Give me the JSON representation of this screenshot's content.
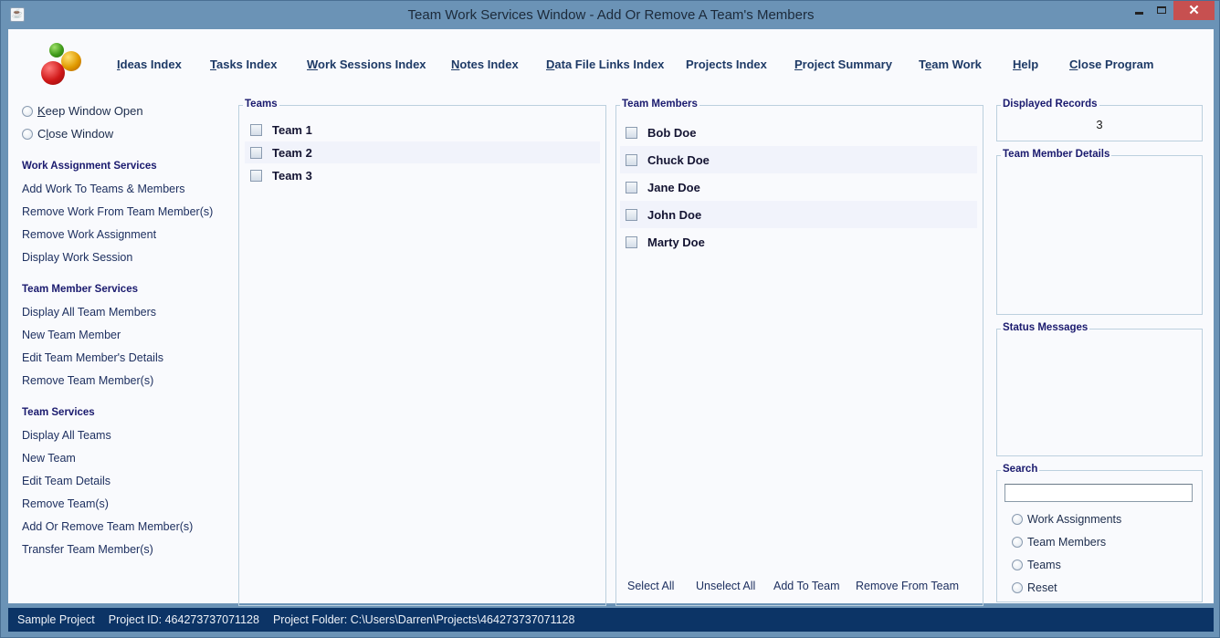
{
  "window": {
    "title": "Team Work Services Window - Add Or Remove A Team's Members",
    "close_glyph": "✕"
  },
  "nav": [
    {
      "mnemonic": "I",
      "rest": "deas Index"
    },
    {
      "mnemonic": "T",
      "rest": "asks Index"
    },
    {
      "mnemonic": "W",
      "rest": "ork Sessions Index"
    },
    {
      "mnemonic": "N",
      "rest": "otes Index"
    },
    {
      "mnemonic": "D",
      "rest": "ata File Links Index"
    },
    {
      "mnemonic": "",
      "rest": "Projects Index"
    },
    {
      "mnemonic": "P",
      "rest": "roject Summary"
    },
    {
      "pre": "T",
      "mnemonic": "e",
      "rest": "am Work"
    },
    {
      "mnemonic": "H",
      "rest": "elp"
    },
    {
      "mnemonic": "C",
      "rest": "lose Program"
    }
  ],
  "window_options": [
    {
      "pre": "",
      "mnemonic": "K",
      "rest": "eep Window Open",
      "selected": false
    },
    {
      "pre": "C",
      "mnemonic": "l",
      "rest": "ose Window",
      "selected": false
    }
  ],
  "sidebar": {
    "work_assignment": {
      "heading": "Work Assignment Services",
      "items": [
        "Add Work To Teams & Members",
        "Remove Work From Team Member(s)",
        "Remove Work Assignment",
        "Display Work Session"
      ]
    },
    "team_member": {
      "heading": "Team Member Services",
      "items": [
        "Display All Team Members",
        "New Team Member",
        "Edit Team Member's Details",
        "Remove Team Member(s)"
      ]
    },
    "team": {
      "heading": "Team Services",
      "items": [
        "Display All Teams",
        "New Team",
        "Edit Team Details",
        "Remove Team(s)",
        "Add Or Remove Team Member(s)",
        "Transfer Team Member(s)"
      ]
    }
  },
  "teams": {
    "label": "Teams",
    "items": [
      {
        "name": "Team 1",
        "checked": false
      },
      {
        "name": "Team 2",
        "checked": false
      },
      {
        "name": "Team 3",
        "checked": false
      }
    ]
  },
  "members": {
    "label": "Team Members",
    "items": [
      {
        "name": "Bob Doe",
        "checked": false
      },
      {
        "name": "Chuck Doe",
        "checked": false
      },
      {
        "name": "Jane Doe",
        "checked": false
      },
      {
        "name": "John Doe",
        "checked": false
      },
      {
        "name": "Marty Doe",
        "checked": false
      }
    ],
    "actions": {
      "select_all": "Select All",
      "unselect_all": "Unselect All",
      "add_to_team": "Add To Team",
      "remove_from_team": "Remove From Team"
    }
  },
  "displayed_records": {
    "label": "Displayed Records",
    "value": "3"
  },
  "member_details": {
    "label": "Team Member Details",
    "content": ""
  },
  "status_messages": {
    "label": "Status Messages",
    "content": ""
  },
  "search": {
    "label": "Search",
    "value": "",
    "options": [
      "Work Assignments",
      "Team Members",
      "Teams",
      "Reset"
    ]
  },
  "statusbar": {
    "project_name": "Sample Project",
    "project_id": "Project ID:  464273737071128",
    "project_folder": "Project Folder: C:\\Users\\Darren\\Projects\\464273737071128"
  }
}
